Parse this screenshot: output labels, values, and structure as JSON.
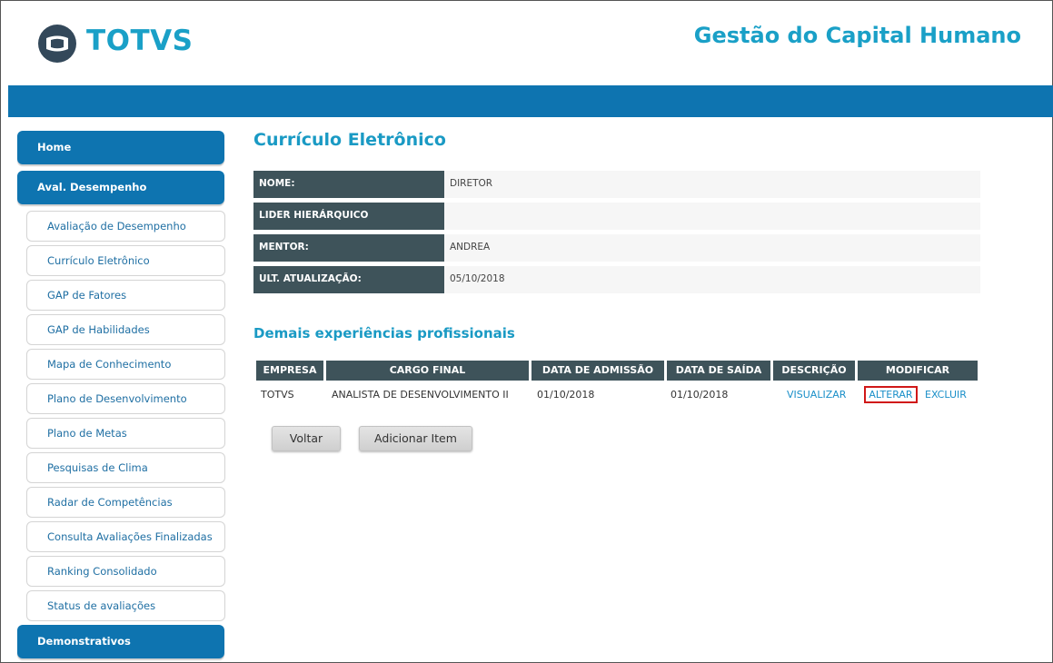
{
  "header": {
    "logo_text": "TOTVS",
    "app_title": "Gestão do Capital Humano"
  },
  "sidebar": {
    "main_items": [
      {
        "label": "Home"
      },
      {
        "label": "Aval. Desempenho"
      },
      {
        "label": "Demonstrativos"
      }
    ],
    "sub_items": [
      {
        "label": "Avaliação de Desempenho"
      },
      {
        "label": "Currículo Eletrônico"
      },
      {
        "label": "GAP de Fatores"
      },
      {
        "label": "GAP de Habilidades"
      },
      {
        "label": "Mapa de Conhecimento"
      },
      {
        "label": "Plano de Desenvolvimento"
      },
      {
        "label": "Plano de Metas"
      },
      {
        "label": "Pesquisas de Clima"
      },
      {
        "label": "Radar de Competências"
      },
      {
        "label": "Consulta Avaliações Finalizadas"
      },
      {
        "label": "Ranking Consolidado"
      },
      {
        "label": "Status de avaliações"
      }
    ]
  },
  "main": {
    "title": "Currículo Eletrônico",
    "info": [
      {
        "label": "NOME:",
        "value": "DIRETOR"
      },
      {
        "label": "LIDER HIERÁRQUICO",
        "value": ""
      },
      {
        "label": "MENTOR:",
        "value": "ANDREA"
      },
      {
        "label": "ULT. ATUALIZAÇÃO:",
        "value": "05/10/2018"
      }
    ],
    "section_title": "Demais experiências profissionais",
    "table": {
      "headers": [
        "EMPRESA",
        "CARGO FINAL",
        "DATA DE ADMISSÃO",
        "DATA DE SAÍDA",
        "DESCRIÇÃO",
        "MODIFICAR"
      ],
      "rows": [
        {
          "empresa": "TOTVS",
          "cargo": "ANALISTA DE DESENVOLVIMENTO II",
          "admissao": "01/10/2018",
          "saida": "01/10/2018",
          "descricao": "VISUALIZAR",
          "alterar": "ALTERAR",
          "excluir": "EXCLUIR"
        }
      ]
    },
    "buttons": {
      "voltar": "Voltar",
      "adicionar": "Adicionar Item"
    }
  },
  "colors": {
    "brand": "#1aa0c7",
    "nav_blue": "#0e74b0",
    "label_dark": "#3e535a",
    "highlight": "#d01818"
  }
}
